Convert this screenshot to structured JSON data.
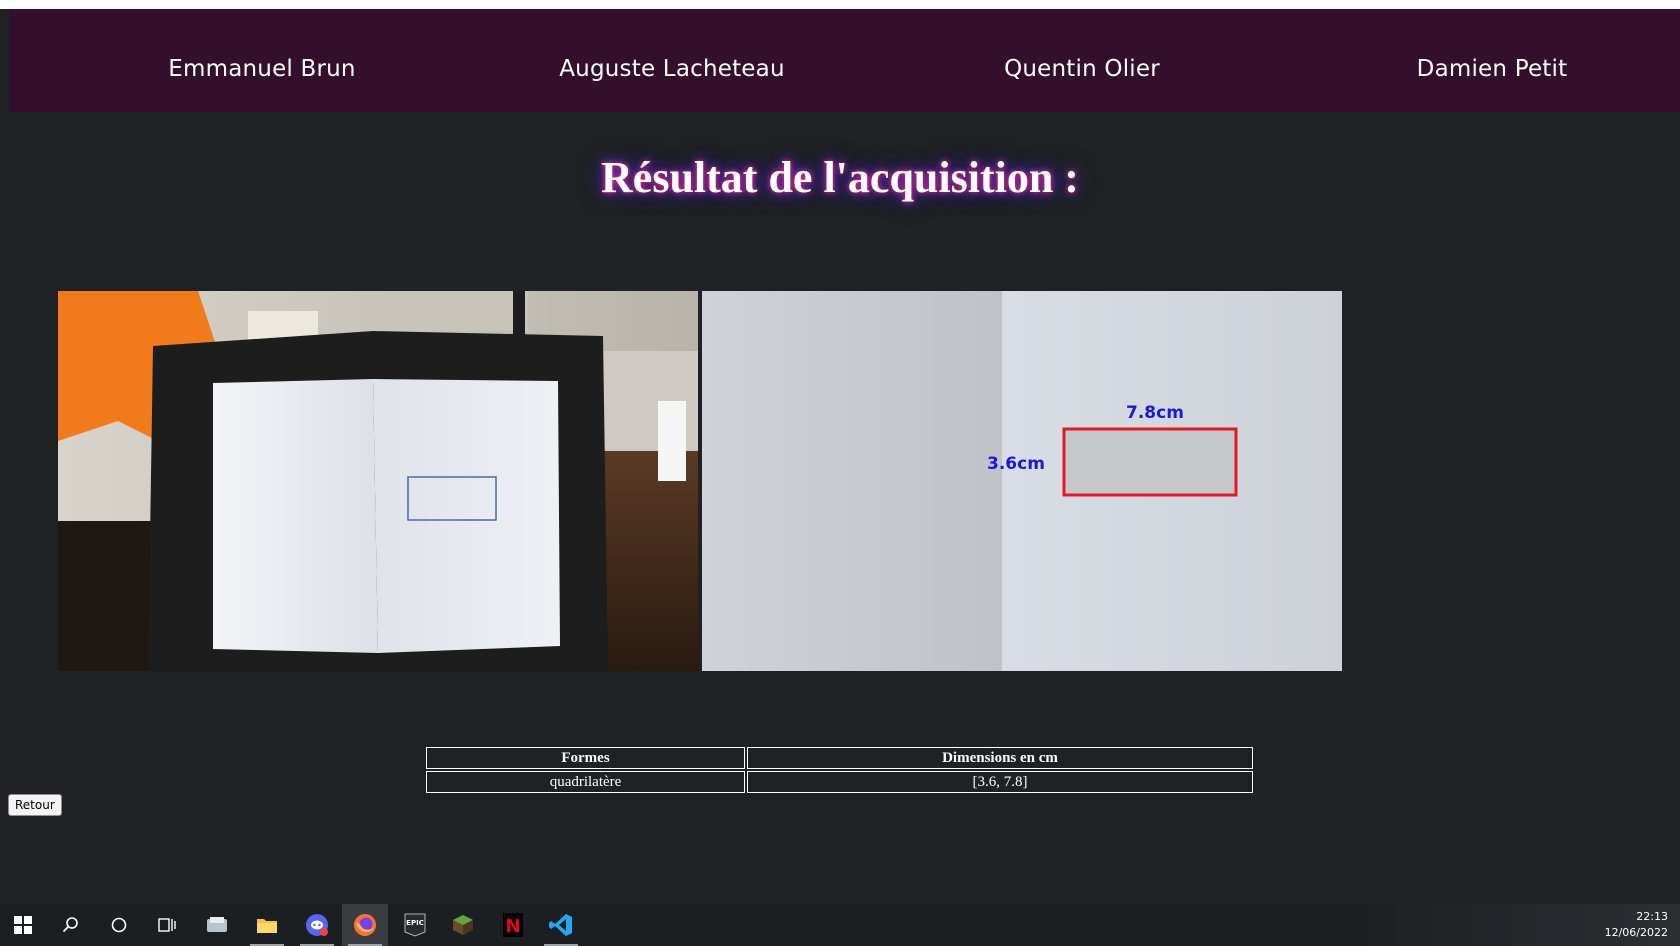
{
  "nav": {
    "items": [
      {
        "label": "Emmanuel Brun"
      },
      {
        "label": "Auguste Lacheteau"
      },
      {
        "label": "Quentin Olier"
      },
      {
        "label": "Damien Petit"
      }
    ]
  },
  "page": {
    "title": "Résultat de l'acquisition :"
  },
  "images": {
    "annotation_width": "7.8cm",
    "annotation_height": "3.6cm"
  },
  "table": {
    "headers": [
      "Formes",
      "Dimensions en cm"
    ],
    "rows": [
      [
        "quadrilatère",
        "[3.6, 7.8]"
      ]
    ]
  },
  "buttons": {
    "retour_label": "Retour"
  },
  "taskbar": {
    "icons": [
      "windows-start-icon",
      "search-icon",
      "cortana-icon",
      "task-view-icon",
      "app-icon",
      "file-explorer-icon",
      "discord-icon",
      "firefox-icon",
      "epic-games-icon",
      "minecraft-icon",
      "netflix-icon",
      "vscode-icon"
    ],
    "epic_label": "EPIC",
    "netflix_label": "N",
    "time": "22:13",
    "date": "12/06/2022"
  },
  "colors": {
    "navbar_bg": "#330f2c",
    "page_bg": "#202124",
    "annotation_box": "#e01b24",
    "annotation_text": "#1a1ad6"
  }
}
